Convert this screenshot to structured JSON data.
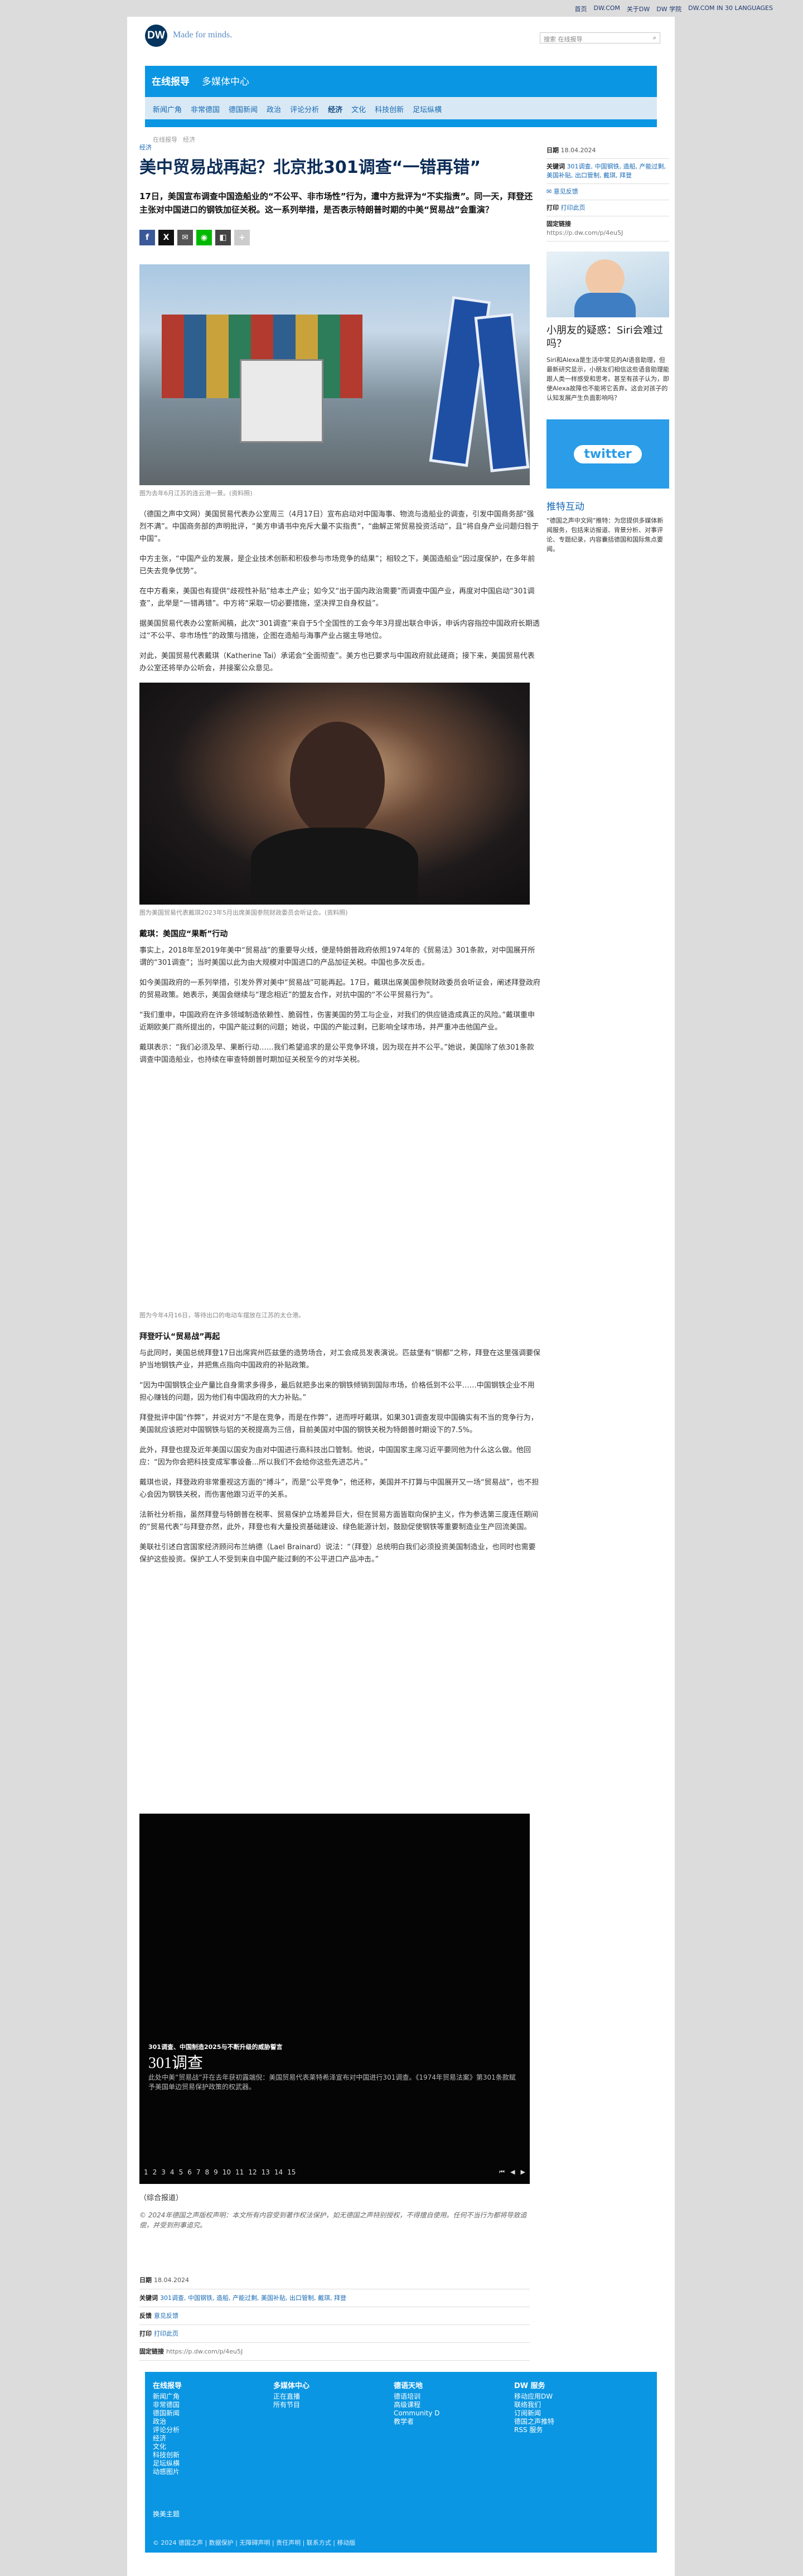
{
  "top": {
    "links": [
      "首页",
      "DW.COM",
      "关于DW",
      "DW 学院",
      "DW.COM IN 30 LANGUAGES"
    ]
  },
  "header": {
    "logo": "DW",
    "slogan": "Made for minds.",
    "search_placeholder": "搜索 在线报导"
  },
  "nav": {
    "primary": [
      "在线报导",
      "多媒体中心"
    ],
    "sub": [
      "新闻广角",
      "非常德国",
      "德国新闻",
      "政治",
      "评论分析",
      "经济",
      "文化",
      "科技创新",
      "足坛纵横"
    ],
    "active": "经济"
  },
  "breadcrumb": [
    "在线报导",
    "经济"
  ],
  "article": {
    "section": "经济",
    "title": "美中贸易战再起？北京批301调查“一错再错”",
    "lead": "17日，美国宣布调查中国造船业的“不公平、非市场性”行为，遭中方批评为“不实指责”。同一天，拜登还主张对中国进口的钢铁加征关税。这一系列举措，是否表示特朗普时期的中美“贸易战”会重演？",
    "caption1": "图为去年6月江苏的连云港一景。(资料照)",
    "paras1": [
      "（德国之声中文网）美国贸易代表办公室周三（4月17日）宣布启动对中国海事、物流与造船业的调查，引发中国商务部“强烈不满”。中国商务部的声明批评，“美方申请书中充斥大量不实指责”，“曲解正常贸易投资活动”，且“将自身产业问题归咎于中国”。",
      "中方主张，“中国产业的发展，是企业技术创新和积极参与市场竞争的结果”；相较之下，美国造船业“因过度保护，在多年前已失去竞争优势”。",
      "在中方看来，美国也有提供“歧视性补贴”给本土产业；如今又“出于国内政治需要”而调查中国产业，再度对中国启动“301调查”，此举是“一错再错”。中方将“采取一切必要措施，坚决捍卫自身权益”。",
      "据美国贸易代表办公室新闻稿，此次“301调查”来自于5个全国性的工会今年3月提出联合申诉，申诉内容指控中国政府长期透过“不公平、非市场性”的政策与措施，企图在造船与海事产业占据主导地位。",
      "对此，美国贸易代表戴琪（Katherine Tai）承诺会“全面彻查”。美方也已要求与中国政府就此磋商；接下来，美国贸易代表办公室还将举办公听会，并接案公众意见。"
    ],
    "caption2": "图为美国贸易代表戴琪2023年5月出席美国参院财政委员会听证会。(资料照)",
    "sub1": "戴琪：美国应“果断”行动",
    "paras2": [
      "事实上，2018年至2019年美中“贸易战”的重要导火线，便是特朗普政府依照1974年的《贸易法》301条款，对中国展开所谓的“301调查”；当时美国以此为由大规模对中国进口的产品加征关税。中国也多次反击。",
      "如今美国政府的一系列举措，引发外界对美中“贸易战”可能再起。17日，戴琪出席美国参院财政委员会听证会，阐述拜登政府的贸易政策。她表示，美国会继续与“理念相近”的盟友合作，对抗中国的“不公平贸易行为”。",
      "“我们重申，中国政府在许多领域制造依赖性、脆弱性，伤害美国的劳工与企业，对我们的供应链造成真正的风险。”戴琪重申近期欧美厂商所提出的，中国产能过剩的问题；她说，中国的产能过剩，已影响全球市场，并严重冲击他国产业。",
      "戴琪表示：“我们必须及早、果断行动……我们希望追求的是公平竞争环境，因为现在并不公平。”她说，美国除了依301条款调查中国造船业，也持续在审查特朗普时期加征关税至今的对华关税。"
    ],
    "caption3": "图为今年4月16日，等待出口的电动车摆放在江苏的太仓港。",
    "sub2": "拜登吁认“贸易战”再起",
    "paras3": [
      "与此同时，美国总统拜登17日出席宾州匹兹堡的造势场合，对工会成员发表演说。匹兹堡有“钢都”之称，拜登在这里强调要保护当地钢铁产业，并把焦点指向中国政府的补贴政策。",
      "“因为中国钢铁企业产量比自身需求多得多，最后就把多出来的钢铁倾销到国际市场，价格低到不公平……中国钢铁企业不用担心赚钱的问题，因为他们有中国政府的大力补贴。”",
      "拜登批评中国“作弊”，并说对方“不是在竞争，而是在作弊”，进而呼吁戴琪，如果301调查发现中国确实有不当的竞争行为，美国就应该把对中国钢铁与铝的关税提高为三倍，目前美国对中国的钢铁关税为特朗普时期设下的7.5%。",
      "此外，拜登也提及近年美国以国安为由对中国进行高科技出口管制。他说，中国国家主席习近平要同他为什么这么做。他回应：“因为你会把科技变成军事设备...所以我们不会给你这些先进芯片。”",
      "戴琪也说，拜登政府非常重视这方面的“搏斗”，而是“公平竞争”，他还称，美国并不打算与中国展开又一场“贸易战”，也不担心会因为钢铁关税，而伤害他跟习近平的关系。",
      "法新社分析指，虽然拜登与特朗普在税率、贸易保护立场差异巨大，但在贸易方面皆取向保护主义，作为参选第三度连任期间的“贸易代表”与拜登亦然，此外，拜登也有大量投资基础建设、绿色能源计划，鼓励促使钢铁等重要制造业生产回流美国。",
      "美联社引述白宫国家经济顾问布兰纳德（Lael Brainard）说法：“（拜登）总统明白我们必须投资美国制造业，也同时也需要保护这些投资。保护工人不受到来自中国产能过剩的不公平进口产品冲击。”"
    ],
    "video": {
      "kicker": "301调查、中国制造2025与不断升级的威胁誓言",
      "title": "301调查",
      "desc": "此处中美“贸易战”开在去年获初露端倪：美国贸易代表莱特希泽宣布对中国进行301调查。《1974年贸易法案》第301条款赋予美国单边贸易保护政策的权武器。",
      "pages": [
        "1",
        "2",
        "3",
        "4",
        "5",
        "6",
        "7",
        "8",
        "9",
        "10",
        "11",
        "12",
        "13",
        "14",
        "15"
      ]
    },
    "source": "（综合报道）",
    "copyright": "© 2024年德国之声版权声明：本文所有内容受到著作权法保护，如无德国之声特别授权，不得擅自使用。任何不当行为都将导致追偿，并受到刑事追究。"
  },
  "meta": {
    "date_label": "日期",
    "date": "18.04.2024",
    "tags_label": "关键词",
    "tags": "301调查, 中国钢铁, 造船, 产能过剩, 美国补贴, 出口管制, 戴琪, 拜登",
    "feedback_label": "反馈",
    "feedback": "意见反馈",
    "print_label": "打印",
    "print": "打印此页",
    "link_label": "固定链接",
    "link": "https://p.dw.com/p/4eu5J"
  },
  "sidebar": {
    "feature_title": "小朋友的疑惑：Siri会难过吗？",
    "feature_text": "Siri和Alexa是生活中常见的AI语音助理，但最新研究显示，小朋友们相信这些语音助理能跟人类一样感受和思考。甚至有孩子认为，即使Alexa故障也不能将它丢弃。这会对孩子的认知发展产生负面影响吗？",
    "twitter": "twitter",
    "promo_title": "推特互动",
    "promo_text": "“德国之声中文网”推特：为您提供多媒体新闻服务，包括来访报道、背景分析、对事评论、专题纪录，内容囊括德国和国际焦点要闻。"
  },
  "footer": {
    "cols": [
      {
        "title": "在线报导",
        "items": [
          "新闻广角",
          "非常德国",
          "德国新闻",
          "政治",
          "评论分析",
          "经济",
          "文化",
          "科技创新",
          "足坛纵横",
          "动感图片"
        ]
      },
      {
        "title": "多媒体中心",
        "items": [
          "正在直播",
          "所有节目"
        ]
      },
      {
        "title": "德语天地",
        "items": [
          "德语培训",
          "高级课程",
          "Community D",
          "教学者"
        ]
      },
      {
        "title": "DW 服务",
        "items": [
          "移动应用DW",
          "联络我们",
          "订阅新闻",
          "德国之声推特",
          "RSS 服务"
        ]
      }
    ],
    "extra": "换美主题",
    "copyright": "© 2024 德国之声 | 数据保护 | 无障碍声明 | 责任声明 | 联系方式 | 移动版"
  }
}
